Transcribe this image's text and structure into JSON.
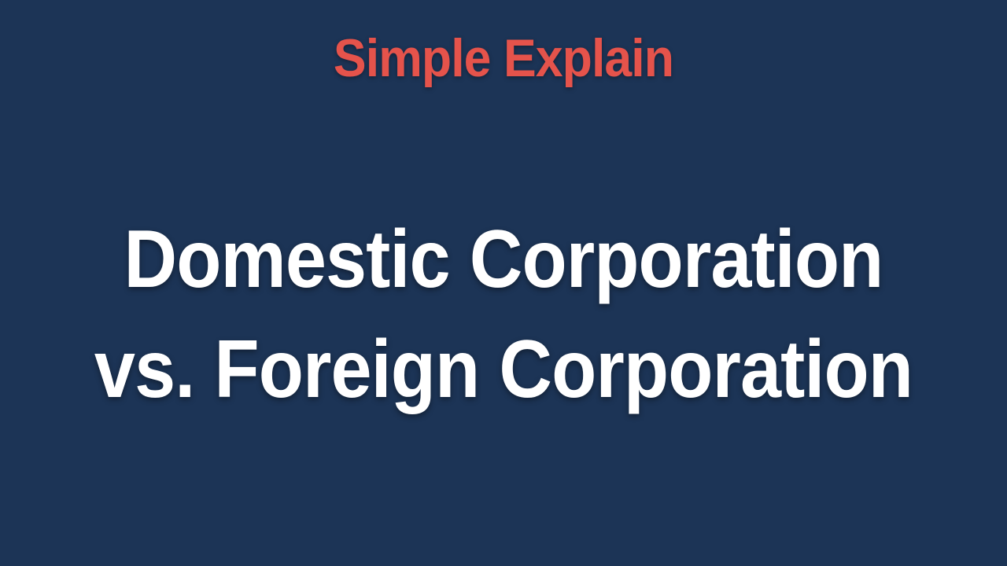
{
  "brand": {
    "name": "Simple Explain",
    "color": "#e5534b"
  },
  "title": {
    "line1": "Domestic Corporation",
    "line2": "vs. Foreign Corporation",
    "color": "#ffffff"
  },
  "background_color": "#1c3456"
}
